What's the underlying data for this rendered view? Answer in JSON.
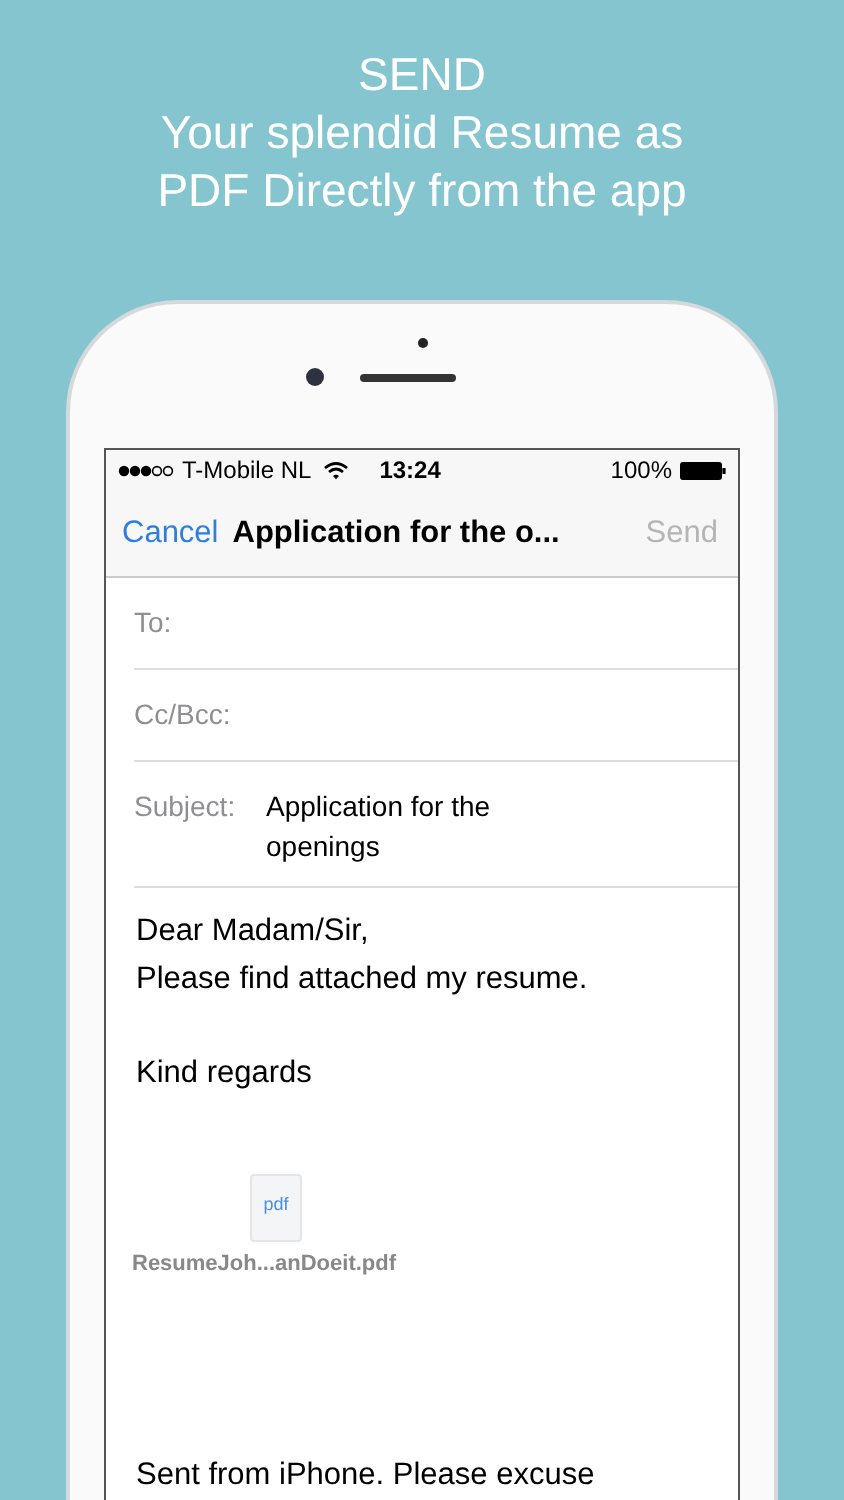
{
  "headline": [
    "SEND",
    "Your splendid Resume as",
    "PDF Directly from the app"
  ],
  "status_bar": {
    "carrier": "T-Mobile NL",
    "time": "13:24",
    "battery": "100%"
  },
  "nav": {
    "cancel": "Cancel",
    "title": "Application for the o...",
    "send": "Send",
    "send_disabled": true
  },
  "fields": [
    {
      "label": "To:"
    },
    {
      "label": "Cc/Bcc:"
    },
    {
      "label": "Subject:",
      "value": "Application for the openings"
    }
  ],
  "body": {
    "greeting": "Dear Madam/Sir,",
    "line": "Please find attached my resume.",
    "closing": "Kind regards"
  },
  "attachment": {
    "icon_label": "pdf",
    "filename": "ResumeJoh...anDoeit.pdf"
  },
  "signature": "Sent from iPhone. Please excuse"
}
